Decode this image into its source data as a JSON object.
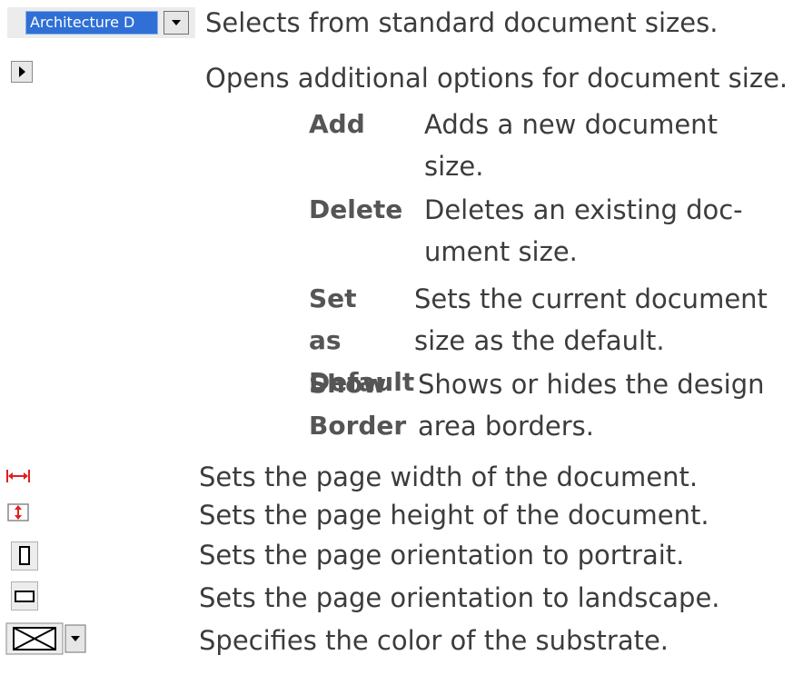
{
  "size_selector": {
    "selected": "Architecture D",
    "description": "Selects from standard document sizes."
  },
  "size_options": {
    "description": "Opens additional options for document size.",
    "items": [
      {
        "term": "Add",
        "description": "Adds a new document size."
      },
      {
        "term": "Delete",
        "description": "Deletes an existing doc-ument size."
      },
      {
        "term": "Set as Default",
        "description": "Sets the current document size as the default."
      },
      {
        "term": "Show Border",
        "description": "Shows or hides the design area borders."
      }
    ]
  },
  "page_width": {
    "icon": "horizontal-arrows-icon",
    "description": "Sets the page width of the document."
  },
  "page_height": {
    "icon": "vertical-arrows-icon",
    "description": "Sets the page height of the document."
  },
  "portrait": {
    "icon": "portrait-icon",
    "description": "Sets the page orientation to portrait."
  },
  "landscape": {
    "icon": "landscape-icon",
    "description": "Sets the page orientation to landscape."
  },
  "substrate": {
    "icon": "no-color-icon",
    "description": "Specifies the color of the substrate."
  },
  "colors": {
    "text": "#3c3c3c",
    "term": "#555555",
    "selection": "#2f6fd6",
    "arrow": "#e02020"
  }
}
